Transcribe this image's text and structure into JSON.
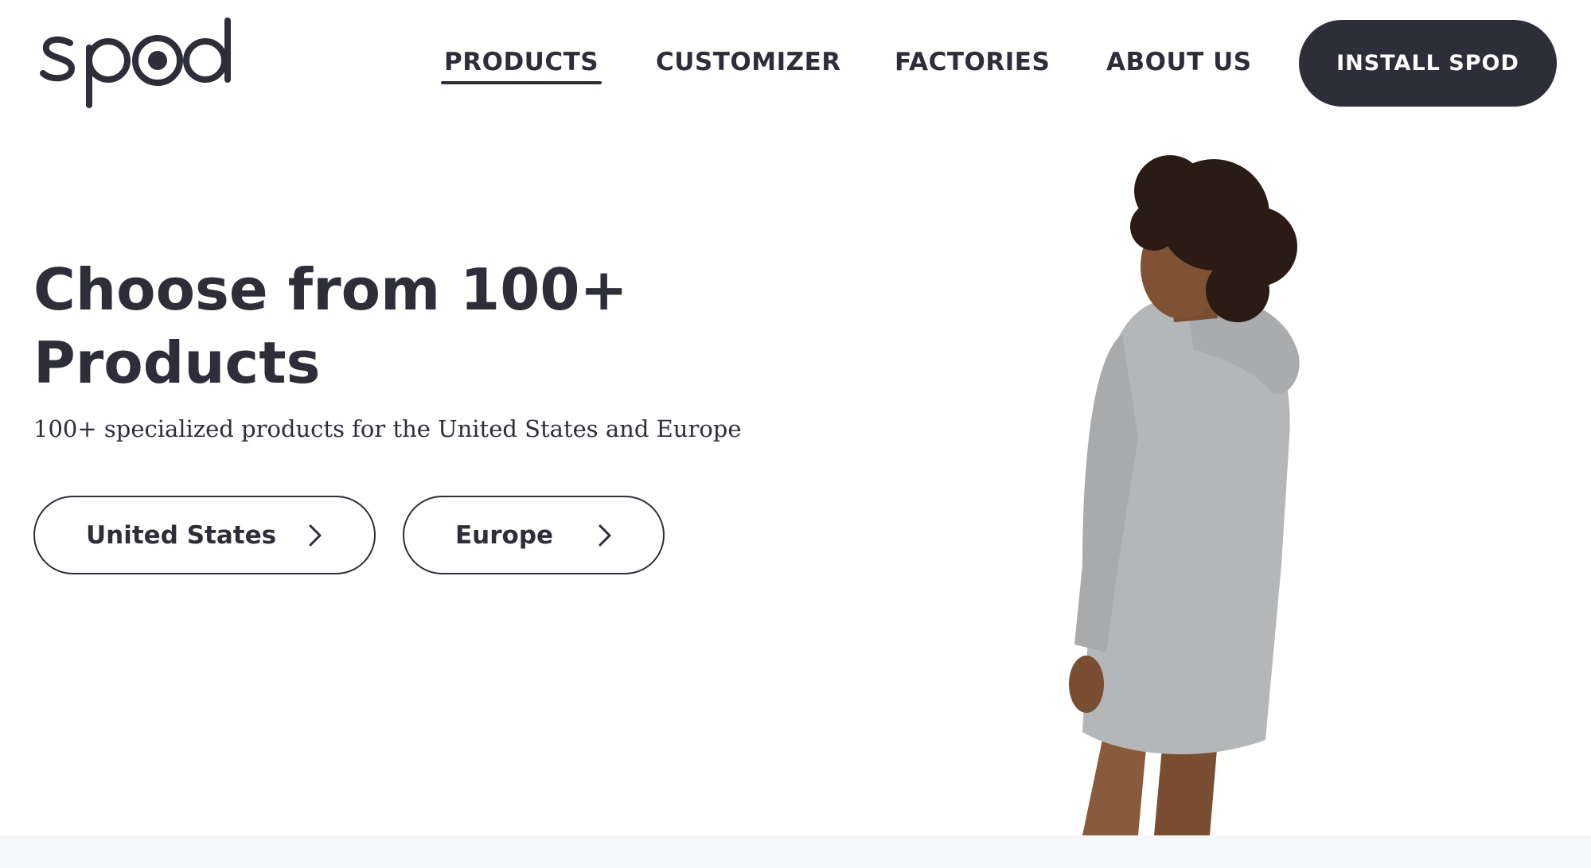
{
  "brand": {
    "logo_icon": "spod-logo",
    "color_dark": "#2e2e3a",
    "background": "#ffffff"
  },
  "nav": {
    "items": [
      {
        "label": "PRODUCTS",
        "active": true
      },
      {
        "label": "CUSTOMIZER",
        "active": false
      },
      {
        "label": "FACTORIES",
        "active": false
      },
      {
        "label": "ABOUT US",
        "active": false
      }
    ],
    "cta_label": "INSTALL SPOD"
  },
  "hero": {
    "title": "Choose from 100+ Products",
    "subtitle": "100+ specialized products for the United States and Europe",
    "buttons": [
      {
        "label": "United States",
        "icon": "chevron-right-icon"
      },
      {
        "label": "Europe",
        "icon": "chevron-right-icon"
      }
    ],
    "image": "model-wearing-grey-hoodie-dress"
  }
}
